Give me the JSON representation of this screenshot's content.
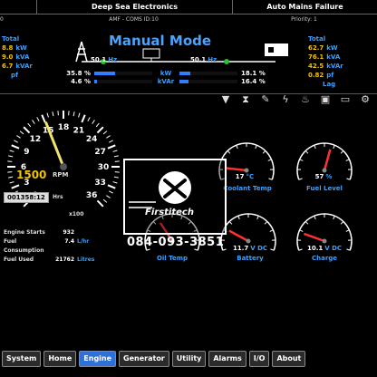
{
  "header": {
    "left": "",
    "title": "Deep Sea Electronics",
    "status": "Auto Mains Failure",
    "sub_left": "0",
    "sub_center": "AMF - COMS ID:10",
    "sub_right": "Priority: 1"
  },
  "left_col": {
    "header": "Total",
    "rows": [
      {
        "num": "8.8",
        "unit": "kW"
      },
      {
        "num": "9.0",
        "unit": "kVA"
      },
      {
        "num": "6.7",
        "unit": "kVAr"
      },
      {
        "num": "",
        "unit": "pf"
      }
    ]
  },
  "right_col": {
    "header": "Total",
    "rows": [
      {
        "num": "62.7",
        "unit": "kW"
      },
      {
        "num": "76.1",
        "unit": "kVA"
      },
      {
        "num": "42.5",
        "unit": "kVAr"
      },
      {
        "num": "0.82",
        "unit": "pf"
      },
      {
        "num": "",
        "unit": "Lag"
      }
    ]
  },
  "mode_title": "Manual Mode",
  "freq_left": {
    "num": "50.1",
    "unit": "Hz"
  },
  "freq_right": {
    "num": "50.1",
    "unit": "Hz"
  },
  "load_bars": [
    {
      "left_pct": "35.8 %",
      "unit": "kW",
      "right_pct": "18.1 %",
      "left_frac": 0.358,
      "right_frac": 0.181
    },
    {
      "left_pct": "4.6 %",
      "unit": "kVAr",
      "right_pct": "16.4 %",
      "left_frac": 0.046,
      "right_frac": 0.164
    }
  ],
  "icons": [
    "filter-icon",
    "hourglass-icon",
    "wrench-icon",
    "lightning-icon",
    "oil-can-icon",
    "fuel-pump-icon",
    "battery-icon",
    "engine-icon"
  ],
  "rpm_gauge": {
    "ticks": [
      "0",
      "3",
      "6",
      "9",
      "12",
      "15",
      "18",
      "21",
      "24",
      "27",
      "30",
      "33",
      "36"
    ],
    "value": "1500",
    "unit": "RPM",
    "multiplier": "x100",
    "hours": "001358:12",
    "hours_unit": "Hrs",
    "reading_frac": 0.42
  },
  "small_gauges": [
    {
      "name": "coolant-temp",
      "value": "17",
      "unit": "°C",
      "label": "Coolant Temp",
      "frac": 0.12
    },
    {
      "name": "fuel-level",
      "value": "57",
      "unit": "%",
      "label": "Fuel Level",
      "frac": 0.57
    },
    {
      "name": "oil-temp",
      "value": "",
      "unit": "",
      "label": "Oil Temp",
      "frac": 0.35
    },
    {
      "name": "battery",
      "value": "11.7",
      "unit": "V DC",
      "label": "Battery",
      "frac": 0.22
    },
    {
      "name": "charge",
      "value": "10.1",
      "unit": "V DC",
      "label": "Charge",
      "frac": 0.18
    }
  ],
  "engine_stats": [
    {
      "k": "Engine Starts",
      "v": "932",
      "u": ""
    },
    {
      "k": "Fuel Consumption",
      "v": "7.4",
      "u": "L/hr"
    },
    {
      "k": "Fuel Used",
      "v": "21762",
      "u": "Litres"
    }
  ],
  "watermark": {
    "brand": "Firstitech",
    "phone": "084-093-3851"
  },
  "nav": [
    {
      "label": "System",
      "active": false
    },
    {
      "label": "Home",
      "active": false
    },
    {
      "label": "Engine",
      "active": true
    },
    {
      "label": "Generator",
      "active": false
    },
    {
      "label": "Utility",
      "active": false
    },
    {
      "label": "Alarms",
      "active": false
    },
    {
      "label": "I/O",
      "active": false
    },
    {
      "label": "About",
      "active": false
    }
  ],
  "colors": {
    "accent": "#3aa0ff",
    "value": "#f2c200",
    "needle": "#ff3030",
    "active_tab": "#2f6fd8"
  }
}
